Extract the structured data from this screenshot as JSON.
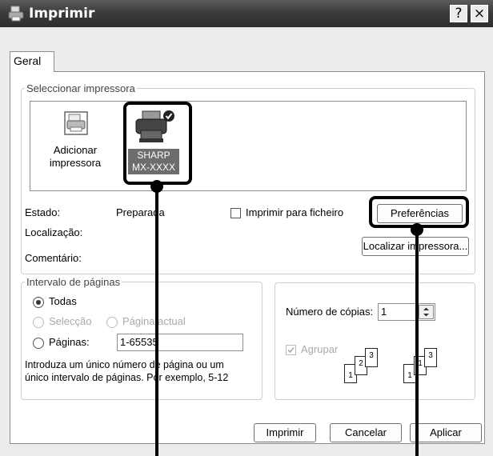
{
  "window": {
    "title": "Imprimir",
    "help_button": "?",
    "close_button": "×"
  },
  "tabs": [
    {
      "label": "Geral"
    }
  ],
  "select_printer": {
    "group_label": "Seleccionar impressora",
    "printers": [
      {
        "label_line1": "Adicionar",
        "label_line2": "impressora",
        "icon": "add-printer-icon"
      },
      {
        "label_line1": "SHARP",
        "label_line2": "MX-XXXX",
        "icon": "printer-icon",
        "selected": true,
        "default": true
      }
    ]
  },
  "status": {
    "estado_label": "Estado:",
    "estado_value": "Preparada",
    "localizacao_label": "Localização:",
    "comentario_label": "Comentário:",
    "print_to_file_label": "Imprimir para ficheiro",
    "preferences_button": "Preferências",
    "find_printer_button": "Localizar impressora..."
  },
  "page_range": {
    "group_label": "Intervalo de páginas",
    "all_label": "Todas",
    "selection_label": "Selecção",
    "current_page_label": "Página actual",
    "pages_label": "Páginas:",
    "pages_value": "1-65535",
    "help_line1": "Introduza um único número de página ou um",
    "help_line2": "único intervalo de páginas. Por exemplo, 5-12"
  },
  "copies": {
    "copies_label": "Número de cópias:",
    "copies_value": "1",
    "collate_label": "Agrupar",
    "collate_icons": [
      "1",
      "2",
      "3",
      "1",
      "1",
      "3"
    ]
  },
  "footer": {
    "print_button": "Imprimir",
    "cancel_button": "Cancelar",
    "apply_button": "Aplicar"
  },
  "colors": {
    "titlebar": "#3c3c3c",
    "dialog": "#ececec",
    "callout": "#000000"
  }
}
